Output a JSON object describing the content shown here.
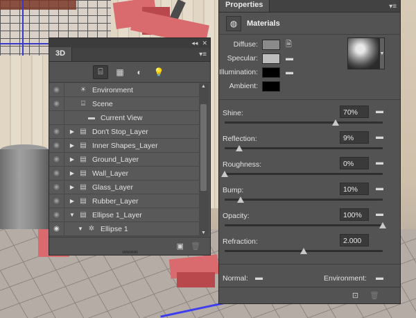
{
  "panel_3d": {
    "tab_label": "3D",
    "topbar_collapse": "◂◂",
    "topbar_close": "✕",
    "tab_menu": "▾≡",
    "toolbar": [
      {
        "name": "scene-filter-icon",
        "glyph": "⌸",
        "active": true
      },
      {
        "name": "mesh-filter-icon",
        "glyph": "▦",
        "active": false
      },
      {
        "name": "material-filter-icon",
        "glyph": "◐",
        "active": false
      },
      {
        "name": "light-filter-icon",
        "glyph": "💡",
        "active": false
      }
    ],
    "layers": [
      {
        "label": "Environment",
        "icon": "☀",
        "twirl": "",
        "eye": true,
        "indent": 0
      },
      {
        "label": "Scene",
        "icon": "⌸",
        "twirl": "",
        "eye": true,
        "indent": 0
      },
      {
        "label": "Current View",
        "icon": "▬",
        "twirl": "",
        "eye": false,
        "indent": 1
      },
      {
        "label": "Don't Stop_Layer",
        "icon": "▤",
        "twirl": "▶",
        "eye": true,
        "indent": 0
      },
      {
        "label": "Inner Shapes_Layer",
        "icon": "▤",
        "twirl": "▶",
        "eye": true,
        "indent": 0
      },
      {
        "label": "Ground_Layer",
        "icon": "▤",
        "twirl": "▶",
        "eye": true,
        "indent": 0
      },
      {
        "label": "Wall_Layer",
        "icon": "▤",
        "twirl": "▶",
        "eye": true,
        "indent": 0
      },
      {
        "label": "Glass_Layer",
        "icon": "▤",
        "twirl": "▶",
        "eye": true,
        "indent": 0
      },
      {
        "label": "Rubber_Layer",
        "icon": "▤",
        "twirl": "▶",
        "eye": true,
        "indent": 0
      },
      {
        "label": "Ellipse 1_Layer",
        "icon": "▤",
        "twirl": "▼",
        "eye": true,
        "indent": 0
      },
      {
        "label": "Ellipse 1",
        "icon": "✲",
        "twirl": "▼",
        "eye": true,
        "indent": 1
      }
    ],
    "footer_new_icon": "▣",
    "footer_delete_icon": "🗑"
  },
  "properties": {
    "tab_label": "Properties",
    "tab_menu": "▾≡",
    "section_title": "Materials",
    "section_icon": "◍",
    "swatches": [
      {
        "label": "Diffuse:",
        "color": "#8a8a8a",
        "folder": "🗎"
      },
      {
        "label": "Specular:",
        "color": "#bdbdbd",
        "folder": "▬"
      },
      {
        "label": "Illumination:",
        "color": "#000000",
        "folder": "▬"
      },
      {
        "label": "Ambient:",
        "color": "#000000",
        "folder": ""
      }
    ],
    "sphere_arrow": "▼",
    "sliders": [
      {
        "label": "Shine:",
        "value": "70%",
        "fraction": 0.7
      },
      {
        "label": "Reflection:",
        "value": "9%",
        "fraction": 0.09
      },
      {
        "label": "Roughness:",
        "value": "0%",
        "fraction": 0.0
      },
      {
        "label": "Bump:",
        "value": "10%",
        "fraction": 0.1
      },
      {
        "label": "Opacity:",
        "value": "100%",
        "fraction": 1.0
      },
      {
        "label": "Refraction:",
        "value": "2.000",
        "fraction": 0.5
      }
    ],
    "normal_label": "Normal:",
    "environment_label": "Environment:",
    "footer_apply_icon": "⊡",
    "footer_delete_icon": "🗑"
  }
}
